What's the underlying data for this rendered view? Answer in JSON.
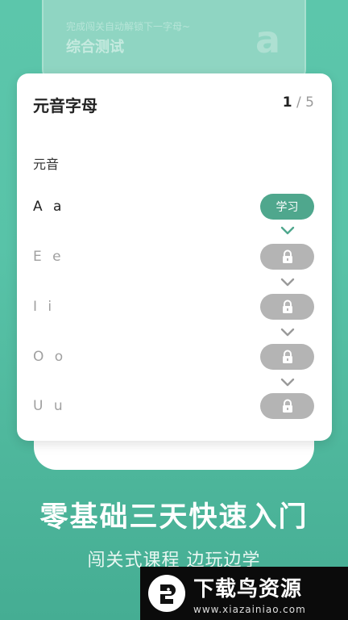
{
  "background_card": {
    "hint": "完成闯关自动解锁下一字母~",
    "title": "综合测试",
    "letter": "a"
  },
  "card": {
    "title": "元音字母",
    "page_current": "1",
    "page_separator": "/",
    "page_total": "5",
    "section_label": "元音",
    "rows": [
      {
        "letters": "A a",
        "state": "learn",
        "button_label": "学习"
      },
      {
        "letters": "E e",
        "state": "locked",
        "icon": "lock-icon"
      },
      {
        "letters": "I i",
        "state": "locked",
        "icon": "lock-icon"
      },
      {
        "letters": "O o",
        "state": "locked",
        "icon": "lock-icon"
      },
      {
        "letters": "U u",
        "state": "locked",
        "icon": "lock-icon"
      }
    ]
  },
  "slogan": "零基础三天快速入门",
  "subslogan": "闯关式课程 边玩边学",
  "watermark": {
    "name": "下载鸟资源",
    "url": "www.xiazainiao.com"
  },
  "colors": {
    "background": "#58c3a8",
    "learn_button": "#4fa78d",
    "locked_button": "#b4b4b4",
    "chevron_active": "#4fa78d",
    "chevron_inactive": "#9a9a9a"
  }
}
